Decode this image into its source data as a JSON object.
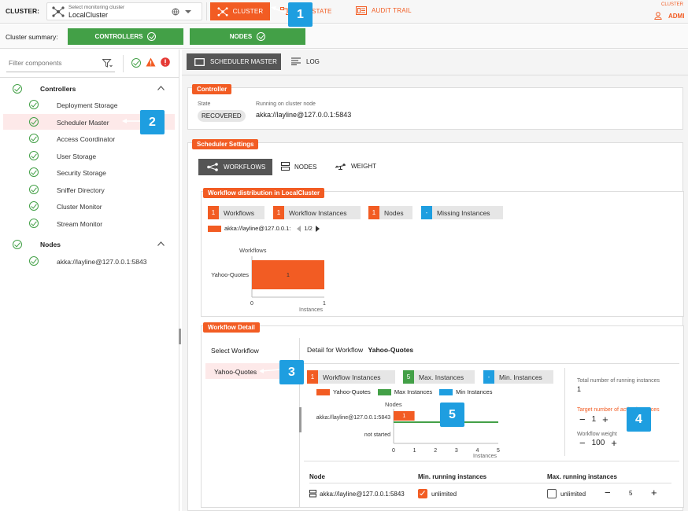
{
  "topbar": {
    "cluster_label": "CLUSTER:",
    "select_hint": "Select monitoring cluster",
    "selected_cluster": "LocalCluster",
    "tab_cluster": "CLUSTER",
    "tab_state": "STATE",
    "tab_audit": "AUDIT TRAIL",
    "user_caption": "CLUSTER",
    "user_name": "ADMI"
  },
  "summary": {
    "label": "Cluster summary:",
    "controllers_btn": "CONTROLLERS",
    "nodes_btn": "NODES"
  },
  "sidebar": {
    "filter_placeholder": "Filter components",
    "controllers_title": "Controllers",
    "controllers": [
      "Deployment Storage",
      "Scheduler Master",
      "Access Coordinator",
      "User Storage",
      "Security Storage",
      "Sniffer Directory",
      "Cluster Monitor",
      "Stream Monitor"
    ],
    "nodes_title": "Nodes",
    "nodes": [
      "akka://layline@127.0.0.1:5843"
    ]
  },
  "content_tabs": {
    "scheduler": "SCHEDULER MASTER",
    "log": "LOG"
  },
  "controller": {
    "tag": "Controller",
    "state_label": "State",
    "state_value": "RECOVERED",
    "running_label": "Running on cluster node",
    "running_value": "akka://layline@127.0.0.1:5843"
  },
  "scheduler_settings": {
    "tag": "Scheduler Settings",
    "tab_workflows": "WORKFLOWS",
    "tab_nodes": "NODES",
    "tab_weight": "WEIGHT"
  },
  "distribution": {
    "tag": "Workflow distribution in LocalCluster",
    "chips": [
      {
        "num": "1",
        "label": "Workflows"
      },
      {
        "num": "1",
        "label": "Workflow Instances"
      },
      {
        "num": "1",
        "label": "Nodes"
      },
      {
        "num": "-",
        "label": "Missing Instances"
      }
    ],
    "legend_node": "akka://layline@127.0.0.1:",
    "pager": "1/2"
  },
  "detail": {
    "tag": "Workflow Detail",
    "select_label": "Select Workflow",
    "workflow_item": "Yahoo-Quotes",
    "detail_for": "Detail for Workflow",
    "detail_name": "Yahoo-Quotes",
    "chips": [
      {
        "num": "1",
        "label": "Workflow Instances"
      },
      {
        "num": "5",
        "label": "Max. Instances"
      },
      {
        "num": "-",
        "label": "Min. Instances"
      }
    ],
    "legend": [
      "Yahoo-Quotes",
      "Max Instances",
      "Min Instances"
    ],
    "total_label": "Total number of running instances",
    "total_value": "1",
    "target_label": "Target number of active instances",
    "target_value": "1",
    "weight_label": "Workflow weight",
    "weight_value": "100",
    "table_headers": [
      "Node",
      "Min. running instances",
      "Max. running instances"
    ],
    "table_row": {
      "node": "akka://layline@127.0.0.1:5843",
      "min": "unlimited",
      "max": "unlimited",
      "max_value": "5"
    }
  },
  "chart_data": [
    {
      "type": "bar",
      "orientation": "horizontal",
      "title": "",
      "ylabel": "Workflows",
      "xlabel": "Instances",
      "categories": [
        "Yahoo-Quotes"
      ],
      "values": [
        1
      ],
      "data_labels": [
        "1"
      ],
      "xlim": [
        0,
        1
      ],
      "xticks": [
        "0",
        "1"
      ]
    },
    {
      "type": "bar",
      "orientation": "horizontal",
      "title": "",
      "ylabel": "Nodes",
      "xlabel": "Instances",
      "categories": [
        "akka://layline@127.0.0.1:5843",
        "not started"
      ],
      "series": [
        {
          "name": "Yahoo-Quotes",
          "values": [
            1,
            0
          ]
        },
        {
          "name": "Max Instances",
          "values": [
            5,
            0
          ]
        },
        {
          "name": "Min Instances",
          "values": [
            0,
            0
          ]
        }
      ],
      "data_labels": [
        "1"
      ],
      "xlim": [
        0,
        5
      ],
      "xticks": [
        "0",
        "1",
        "2",
        "3",
        "4",
        "5"
      ]
    }
  ],
  "callouts": [
    "1",
    "2",
    "3",
    "4",
    "5"
  ],
  "colors": {
    "accent": "#f25c23",
    "green": "#43a047",
    "blue": "#1e9ee0",
    "selected_bg": "#fde9e9"
  }
}
